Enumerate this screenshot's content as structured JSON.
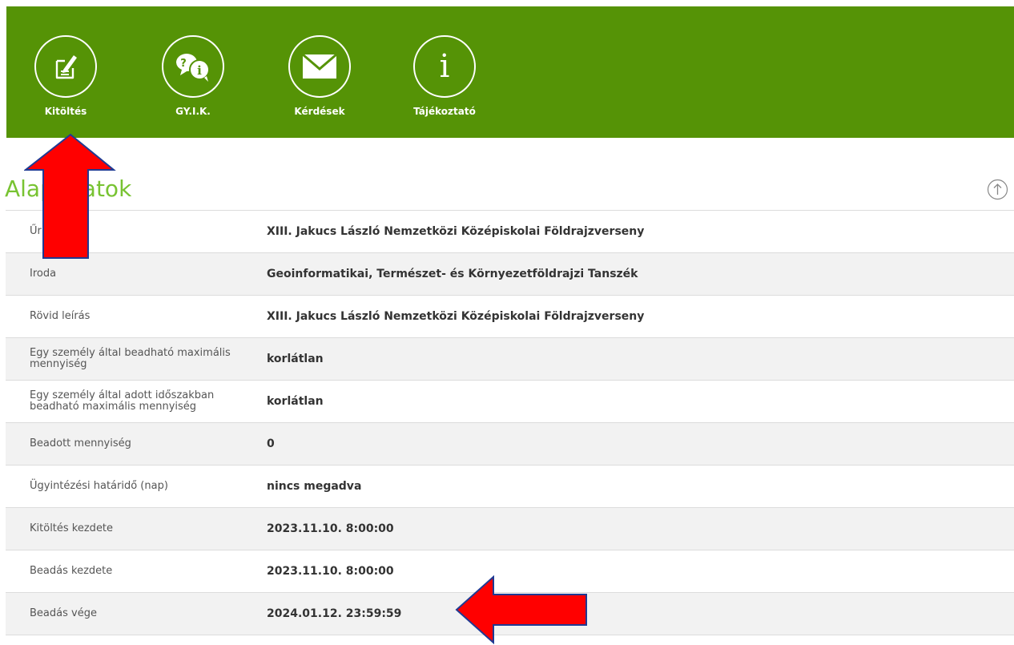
{
  "nav": {
    "items": [
      {
        "label": "Kitöltés",
        "icon": "form-edit-icon"
      },
      {
        "label": "GY.I.K.",
        "icon": "faq-bubbles-icon"
      },
      {
        "label": "Kérdések",
        "icon": "envelope-icon"
      },
      {
        "label": "Tájékoztató",
        "icon": "info-icon"
      }
    ],
    "info_glyph": "i",
    "faq_glyph_q": "?",
    "faq_glyph_i": "i"
  },
  "section": {
    "title": "Alapadatok",
    "scroll_top_icon": "arrow-up-circle-icon"
  },
  "details": [
    {
      "label": "Űrlap neve",
      "value": "XIII. Jakucs László Nemzetközi Középiskolai Földrajzverseny"
    },
    {
      "label": "Iroda",
      "value": "Geoinformatikai, Természet- és Környezetföldrajzi Tanszék"
    },
    {
      "label": "Rövid leírás",
      "value": "XIII. Jakucs László Nemzetközi Középiskolai Földrajzverseny"
    },
    {
      "label": "Egy személy által beadható maximális mennyiség",
      "value": "korlátlan"
    },
    {
      "label": "Egy személy által adott időszakban beadható maximális mennyiség",
      "value": "korlátlan"
    },
    {
      "label": "Beadott mennyiség",
      "value": "0"
    },
    {
      "label": "Ügyintézési határidő (nap)",
      "value": "nincs megadva"
    },
    {
      "label": "Kitöltés kezdete",
      "value": "2023.11.10. 8:00:00"
    },
    {
      "label": "Beadás kezdete",
      "value": "2023.11.10. 8:00:00"
    },
    {
      "label": "Beadás vége",
      "value": "2024.01.12. 23:59:59"
    }
  ],
  "colors": {
    "header_bg": "#559306",
    "title_green": "#78c332",
    "annotation_arrow": "#ff0000",
    "annotation_outline": "#1f3a93"
  }
}
